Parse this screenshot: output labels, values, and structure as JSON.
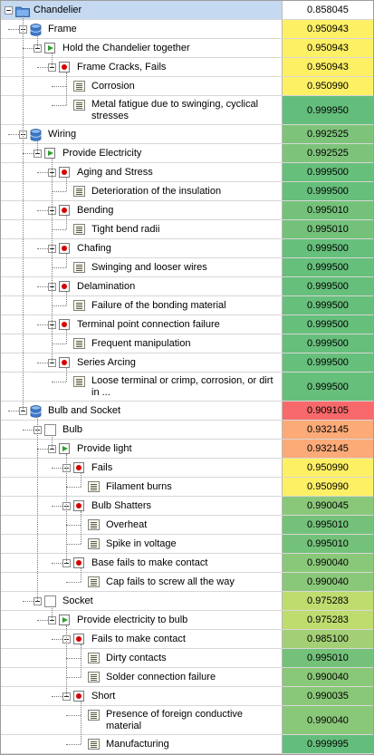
{
  "nodes": [
    {
      "label": "Chandelier",
      "value": "0.858045",
      "level": 0,
      "icon": "folder-icon",
      "color": "#ffffff",
      "selected": true
    },
    {
      "label": "Frame",
      "value": "0.950943",
      "level": 1,
      "icon": "database-icon",
      "color": "#fef065"
    },
    {
      "label": "Hold the Chandelier together",
      "value": "0.950943",
      "level": 2,
      "icon": "function-icon",
      "color": "#fef065"
    },
    {
      "label": "Frame Cracks, Fails",
      "value": "0.950943",
      "level": 3,
      "icon": "failure-mode-icon",
      "color": "#fef065"
    },
    {
      "label": "Corrosion",
      "value": "0.950990",
      "level": 4,
      "icon": "cause-icon",
      "color": "#fef065"
    },
    {
      "label": "Metal fatigue due to swinging, cyclical stresses",
      "value": "0.999950",
      "level": 4,
      "icon": "cause-icon",
      "color": "#63be7b",
      "tall": true
    },
    {
      "label": "Wiring",
      "value": "0.992525",
      "level": 1,
      "icon": "database-icon",
      "color": "#7dc47a"
    },
    {
      "label": "Provide Electricity",
      "value": "0.992525",
      "level": 2,
      "icon": "function-icon",
      "color": "#7dc47a"
    },
    {
      "label": "Aging and Stress",
      "value": "0.999500",
      "level": 3,
      "icon": "failure-mode-icon",
      "color": "#66bf7b"
    },
    {
      "label": "Deterioration of the insulation",
      "value": "0.999500",
      "level": 4,
      "icon": "cause-icon",
      "color": "#66bf7b"
    },
    {
      "label": "Bending",
      "value": "0.995010",
      "level": 3,
      "icon": "failure-mode-icon",
      "color": "#74c27a"
    },
    {
      "label": "Tight bend radii",
      "value": "0.995010",
      "level": 4,
      "icon": "cause-icon",
      "color": "#74c27a"
    },
    {
      "label": "Chafing",
      "value": "0.999500",
      "level": 3,
      "icon": "failure-mode-icon",
      "color": "#66bf7b"
    },
    {
      "label": "Swinging and looser wires",
      "value": "0.999500",
      "level": 4,
      "icon": "cause-icon",
      "color": "#66bf7b"
    },
    {
      "label": "Delamination",
      "value": "0.999500",
      "level": 3,
      "icon": "failure-mode-icon",
      "color": "#66bf7b"
    },
    {
      "label": "Failure of the bonding material",
      "value": "0.999500",
      "level": 4,
      "icon": "cause-icon",
      "color": "#66bf7b"
    },
    {
      "label": "Terminal point connection failure",
      "value": "0.999500",
      "level": 3,
      "icon": "failure-mode-icon",
      "color": "#66bf7b"
    },
    {
      "label": "Frequent manipulation",
      "value": "0.999500",
      "level": 4,
      "icon": "cause-icon",
      "color": "#66bf7b"
    },
    {
      "label": "Series Arcing",
      "value": "0.999500",
      "level": 3,
      "icon": "failure-mode-icon",
      "color": "#66bf7b"
    },
    {
      "label": "Loose terminal or crimp, corrosion, or dirt in ...",
      "value": "0.999500",
      "level": 4,
      "icon": "cause-icon",
      "color": "#66bf7b",
      "tall": true
    },
    {
      "label": "Bulb and Socket",
      "value": "0.909105",
      "level": 1,
      "icon": "database-icon",
      "color": "#f8696b"
    },
    {
      "label": "Bulb",
      "value": "0.932145",
      "level": 2,
      "icon": "blank-icon",
      "color": "#fcaa77"
    },
    {
      "label": "Provide light",
      "value": "0.932145",
      "level": 3,
      "icon": "function-icon",
      "color": "#fcaa77"
    },
    {
      "label": "Fails",
      "value": "0.950990",
      "level": 4,
      "icon": "failure-mode-icon",
      "color": "#fef065"
    },
    {
      "label": "Filament burns",
      "value": "0.950990",
      "level": 5,
      "icon": "cause-icon",
      "color": "#fef065"
    },
    {
      "label": "Bulb Shatters",
      "value": "0.990045",
      "level": 4,
      "icon": "failure-mode-icon",
      "color": "#8ac879"
    },
    {
      "label": "Overheat",
      "value": "0.995010",
      "level": 5,
      "icon": "cause-icon",
      "color": "#74c27a"
    },
    {
      "label": "Spike in voltage",
      "value": "0.995010",
      "level": 5,
      "icon": "cause-icon",
      "color": "#74c27a"
    },
    {
      "label": "Base fails to make contact",
      "value": "0.990040",
      "level": 4,
      "icon": "failure-mode-icon",
      "color": "#8ac879"
    },
    {
      "label": "Cap fails to screw all the way",
      "value": "0.990040",
      "level": 5,
      "icon": "cause-icon",
      "color": "#8ac879"
    },
    {
      "label": "Socket",
      "value": "0.975283",
      "level": 2,
      "icon": "blank-icon",
      "color": "#bfdc6f"
    },
    {
      "label": "Provide electricity to bulb",
      "value": "0.975283",
      "level": 3,
      "icon": "function-icon",
      "color": "#bfdc6f"
    },
    {
      "label": "Fails to make contact",
      "value": "0.985100",
      "level": 4,
      "icon": "failure-mode-icon",
      "color": "#a3d075"
    },
    {
      "label": "Dirty contacts",
      "value": "0.995010",
      "level": 5,
      "icon": "cause-icon",
      "color": "#74c27a"
    },
    {
      "label": "Solder connection failure",
      "value": "0.990040",
      "level": 5,
      "icon": "cause-icon",
      "color": "#8ac879"
    },
    {
      "label": "Short",
      "value": "0.990035",
      "level": 4,
      "icon": "failure-mode-icon",
      "color": "#8ac879"
    },
    {
      "label": "Presence of foreign conductive material",
      "value": "0.990040",
      "level": 5,
      "icon": "cause-icon",
      "color": "#8ac879",
      "tall": true
    },
    {
      "label": "Manufacturing",
      "value": "0.999995",
      "level": 5,
      "icon": "cause-icon",
      "color": "#63be7b"
    }
  ]
}
